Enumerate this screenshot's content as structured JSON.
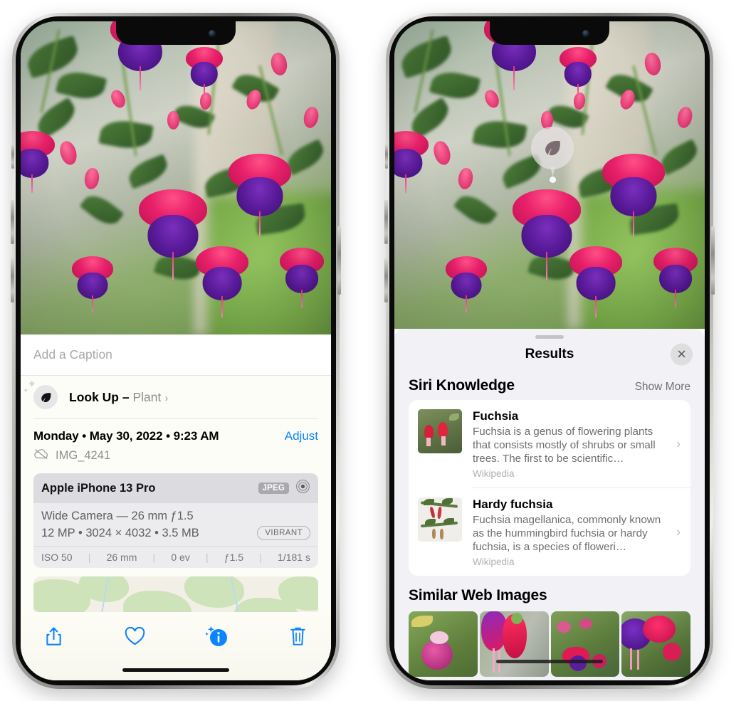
{
  "left_phone": {
    "caption": {
      "placeholder": "Add a Caption",
      "value": ""
    },
    "lookup": {
      "label": "Look Up",
      "dash": "–",
      "subject": "Plant",
      "chevron": "›",
      "icon": "leaf-icon"
    },
    "metadata": {
      "date": "Monday • May 30, 2022 • 9:23 AM",
      "adjust_label": "Adjust",
      "filename": "IMG_4241",
      "cloud_icon": "cloud-slash-icon"
    },
    "camera_card": {
      "device": "Apple iPhone 13 Pro",
      "format_badge": "JPEG",
      "aperture_icon": "aperture-icon",
      "lens_line": "Wide Camera — 26 mm ƒ1.5",
      "specs_line": "12 MP • 3024 × 4032 • 3.5 MB",
      "style_badge": "VIBRANT",
      "exif": [
        "ISO 50",
        "26 mm",
        "0 ev",
        "ƒ1.5",
        "1/181 s"
      ]
    },
    "toolbar": [
      {
        "name": "share-button",
        "icon": "share-icon"
      },
      {
        "name": "favorite-button",
        "icon": "heart-icon"
      },
      {
        "name": "info-button",
        "icon": "info-sparkle-icon"
      },
      {
        "name": "delete-button",
        "icon": "trash-icon"
      }
    ],
    "accent_color": "#0a84ff"
  },
  "right_phone": {
    "visual_lookup_badge": {
      "icon": "leaf-icon"
    },
    "sheet": {
      "title": "Results",
      "close_label": "✕",
      "siri_section": {
        "title": "Siri Knowledge",
        "show_more": "Show More"
      },
      "results": [
        {
          "title": "Fuchsia",
          "description": "Fuchsia is a genus of flowering plants that consists mostly of shrubs or small trees. The first to be scientific…",
          "source": "Wikipedia",
          "chevron": "›"
        },
        {
          "title": "Hardy fuchsia",
          "description": "Fuchsia magellanica, commonly known as the hummingbird fuchsia or hardy fuchsia, is a species of floweri…",
          "source": "Wikipedia",
          "chevron": "›"
        }
      ],
      "similar_section": {
        "title": "Similar Web Images",
        "count": 4
      }
    }
  }
}
